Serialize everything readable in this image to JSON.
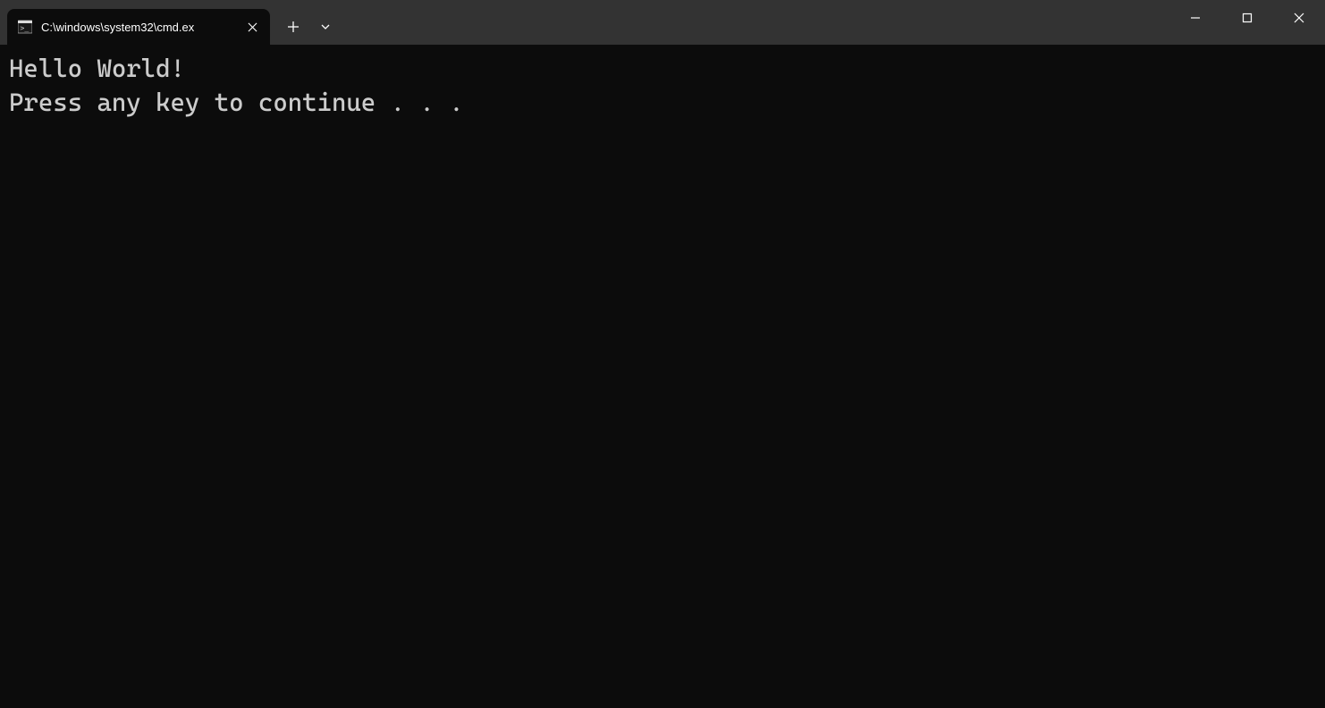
{
  "tab": {
    "title": "C:\\windows\\system32\\cmd.ex",
    "icon": "cmd-icon"
  },
  "terminal": {
    "lines": [
      "Hello World!",
      "Press any key to continue . . ."
    ]
  }
}
